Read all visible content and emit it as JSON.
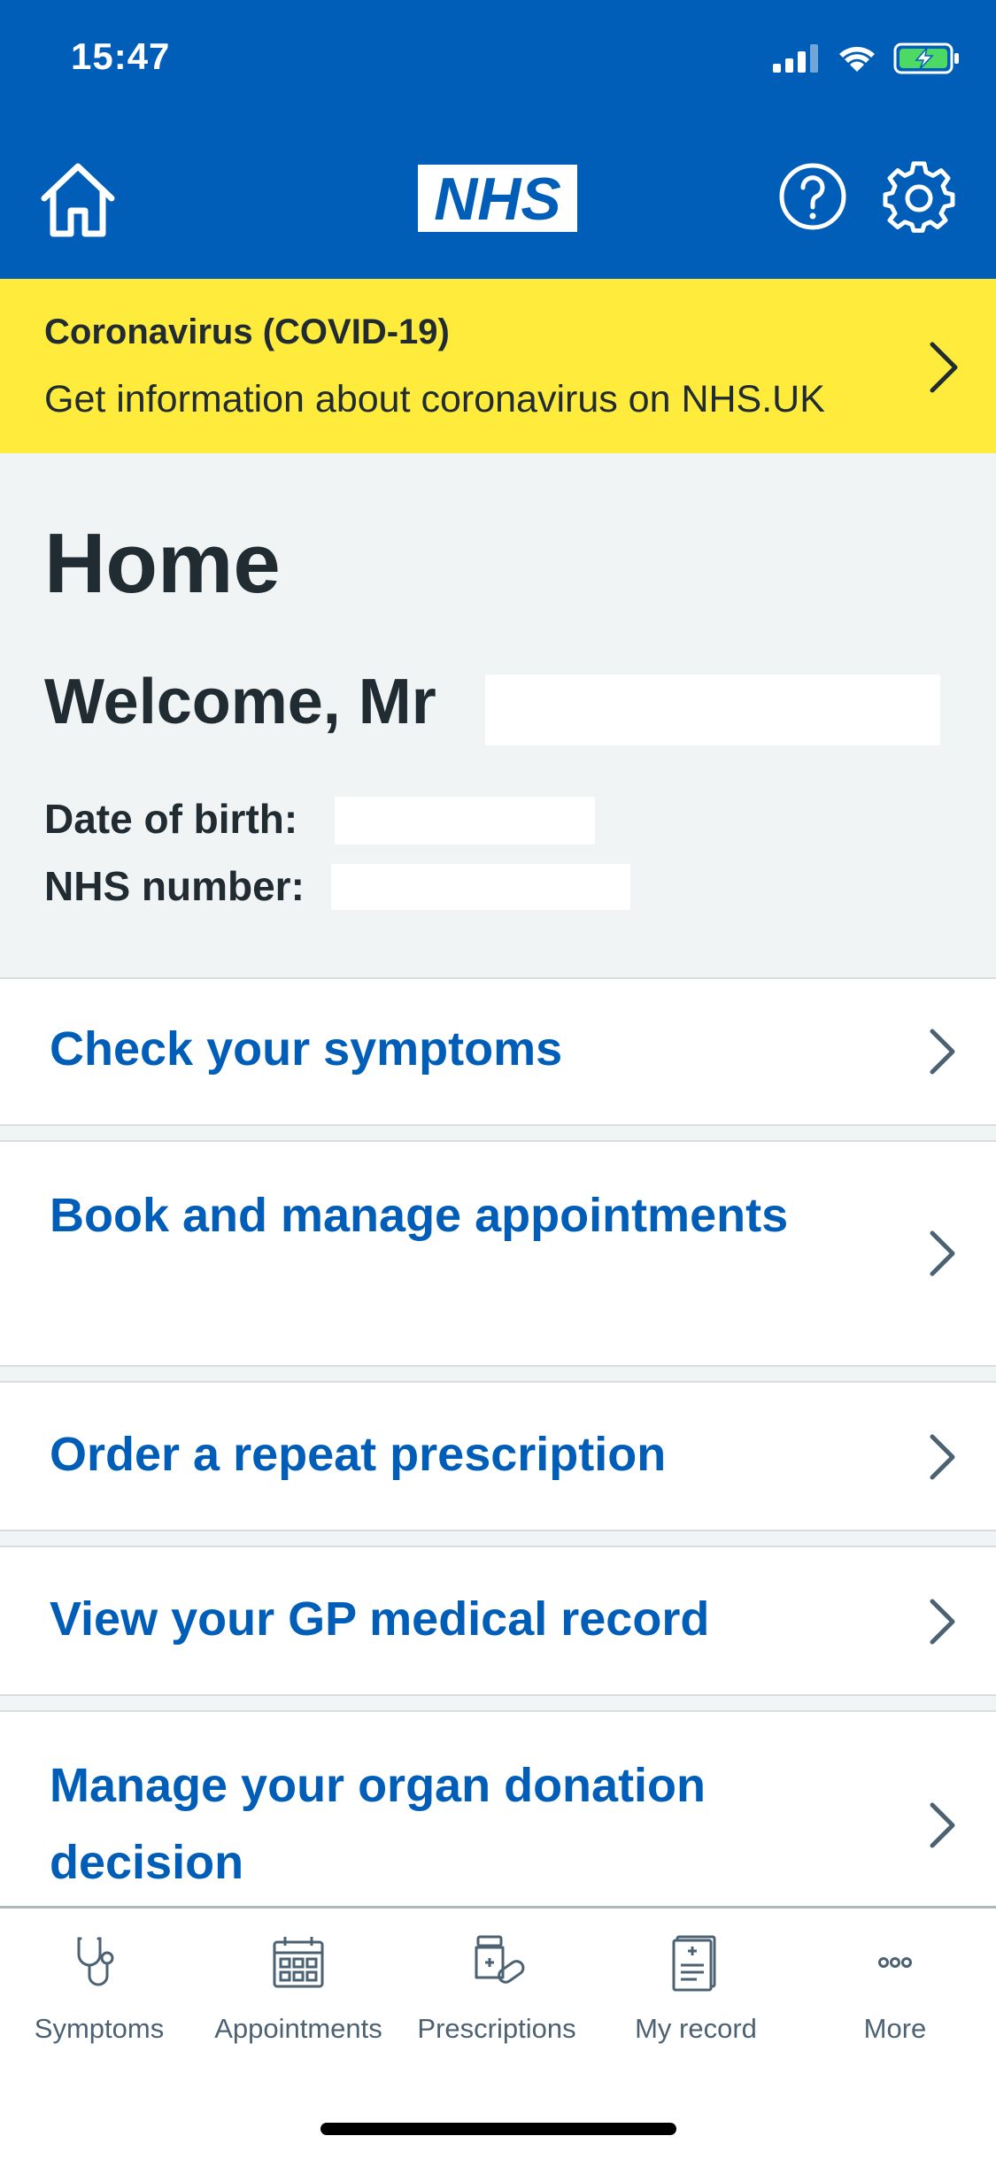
{
  "status_bar": {
    "time": "15:47"
  },
  "header": {
    "logo_text": "NHS",
    "brand_color": "#005eb8"
  },
  "banner": {
    "title": "Coronavirus (COVID-19)",
    "text": "Get information about coronavirus on NHS.UK",
    "color": "#ffeb3b"
  },
  "page": {
    "title": "Home",
    "welcome": "Welcome, Mr",
    "dob_label": "Date of birth:",
    "nhs_number_label": "NHS number:"
  },
  "menu": {
    "items": [
      {
        "label": "Check your symptoms"
      },
      {
        "label": "Book and manage appointments"
      },
      {
        "label": "Order a repeat prescription"
      },
      {
        "label": "View your GP medical record"
      },
      {
        "label": "Manage your organ donation decision"
      }
    ]
  },
  "tabs": {
    "items": [
      {
        "label": "Symptoms",
        "icon": "stethoscope-icon"
      },
      {
        "label": "Appointments",
        "icon": "calendar-icon"
      },
      {
        "label": "Prescriptions",
        "icon": "pills-icon"
      },
      {
        "label": "My record",
        "icon": "record-icon"
      },
      {
        "label": "More",
        "icon": "more-icon"
      }
    ]
  }
}
